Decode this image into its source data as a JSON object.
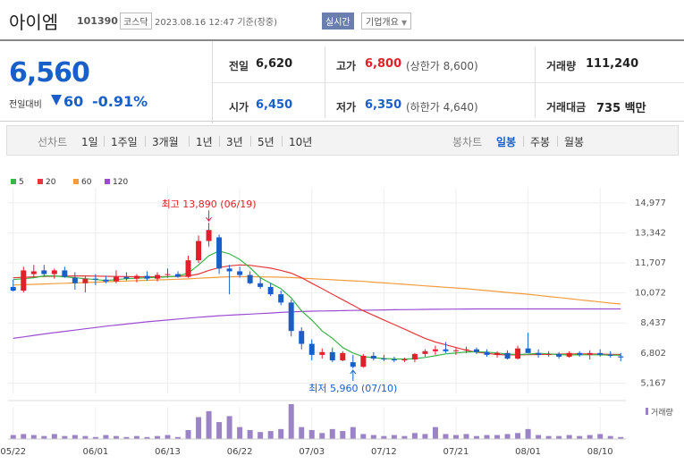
{
  "header": {
    "name": "아이엠",
    "code": "101390",
    "market": "코스닥",
    "time": "2023.08.16 12:47 기준(장중)",
    "realtime": "실시간",
    "company_info": "기업개요"
  },
  "summary": {
    "price": "6,560",
    "change_label": "전일대비",
    "change": "60",
    "change_pct": "-0.91%",
    "prev_label": "전일",
    "prev": "6,620",
    "open_label": "시가",
    "open": "6,450",
    "high_label": "고가",
    "high": "6,800",
    "upper_limit": "(상한가 8,600)",
    "low_label": "저가",
    "low": "6,350",
    "lower_limit": "(하한가 4,640)",
    "volume_label": "거래량",
    "volume": "111,240",
    "amount_label": "거래대금",
    "amount": "735 백만"
  },
  "toolbar": {
    "line_label": "선차트",
    "line_items": [
      "1일",
      "1주일",
      "3개월",
      "1년",
      "3년",
      "5년",
      "10년"
    ],
    "candle_label": "봉차트",
    "candle_items": [
      "일봉",
      "주봉",
      "월봉"
    ]
  },
  "chart_data": {
    "type": "candlestick",
    "legend": [
      "5",
      "20",
      "60",
      "120"
    ],
    "legend_colors": [
      "#3bb54a",
      "#e5383b",
      "#f39c3d",
      "#9b4dd1"
    ],
    "y_ticks": [
      "14,977",
      "13,342",
      "11,707",
      "10,072",
      "8,437",
      "6,802",
      "5,167"
    ],
    "y_values": [
      14977,
      13342,
      11707,
      10072,
      8437,
      6802,
      5167
    ],
    "ylim": [
      4600,
      15800
    ],
    "x_ticks": [
      "05/22",
      "06/01",
      "06/13",
      "06/22",
      "07/03",
      "07/12",
      "07/21",
      "08/01",
      "08/10"
    ],
    "x_tick_index": [
      0,
      8,
      15,
      22,
      29,
      36,
      43,
      50,
      57
    ],
    "max_annot": "최고 13,890 (06/19)",
    "min_annot": "최저 5,960 (07/10)",
    "volume_label": "거래량",
    "candles": [
      [
        10400,
        10800,
        10150,
        10200
      ],
      [
        10200,
        11500,
        10100,
        11300
      ],
      [
        11100,
        11600,
        10900,
        11250
      ],
      [
        11300,
        11600,
        10950,
        11100
      ],
      [
        11100,
        11400,
        10850,
        11300
      ],
      [
        11300,
        11500,
        10900,
        10950
      ],
      [
        10900,
        11200,
        10250,
        10600
      ],
      [
        10600,
        11000,
        10100,
        10850
      ],
      [
        10850,
        11100,
        10500,
        10800
      ],
      [
        10800,
        11000,
        10600,
        10700
      ],
      [
        10700,
        11300,
        10600,
        10950
      ],
      [
        10950,
        11200,
        10750,
        10850
      ],
      [
        10850,
        11100,
        10650,
        11000
      ],
      [
        11000,
        11250,
        10750,
        10850
      ],
      [
        10850,
        11200,
        10700,
        11050
      ],
      [
        11050,
        11400,
        10900,
        11100
      ],
      [
        11100,
        11250,
        10900,
        10950
      ],
      [
        10950,
        12100,
        10900,
        11850
      ],
      [
        11850,
        13200,
        11700,
        12900
      ],
      [
        12900,
        13890,
        12600,
        13500
      ],
      [
        13100,
        13250,
        11100,
        11400
      ],
      [
        11400,
        11600,
        10000,
        11250
      ],
      [
        11250,
        11500,
        10900,
        11050
      ],
      [
        11050,
        11250,
        10550,
        10600
      ],
      [
        10600,
        10900,
        10300,
        10400
      ],
      [
        10400,
        10600,
        9900,
        10000
      ],
      [
        10000,
        10200,
        9400,
        9550
      ],
      [
        9550,
        9700,
        7700,
        8000
      ],
      [
        8000,
        8200,
        7000,
        7300
      ],
      [
        7300,
        7550,
        6400,
        6700
      ],
      [
        6700,
        7050,
        6500,
        6850
      ],
      [
        6850,
        7100,
        6300,
        6400
      ],
      [
        6400,
        6900,
        6350,
        6800
      ],
      [
        6300,
        6700,
        5960,
        6050
      ],
      [
        6050,
        6750,
        6000,
        6650
      ],
      [
        6650,
        6850,
        6400,
        6500
      ],
      [
        6500,
        6700,
        6350,
        6450
      ],
      [
        6450,
        6600,
        6300,
        6400
      ],
      [
        6400,
        6550,
        6300,
        6450
      ],
      [
        6450,
        6800,
        6300,
        6750
      ],
      [
        6750,
        7000,
        6600,
        6900
      ],
      [
        6900,
        7200,
        6700,
        7000
      ],
      [
        7000,
        7400,
        6800,
        6900
      ],
      [
        6900,
        7100,
        6700,
        6950
      ],
      [
        6950,
        7150,
        6800,
        7000
      ],
      [
        7000,
        7100,
        6750,
        6850
      ],
      [
        6850,
        7000,
        6600,
        6700
      ],
      [
        6700,
        6900,
        6550,
        6800
      ],
      [
        6800,
        6950,
        6450,
        6500
      ],
      [
        6500,
        7200,
        6450,
        7050
      ],
      [
        7050,
        7900,
        6800,
        6800
      ],
      [
        6800,
        7000,
        6550,
        6700
      ],
      [
        6700,
        6900,
        6600,
        6750
      ],
      [
        6750,
        6850,
        6500,
        6600
      ],
      [
        6600,
        6900,
        6550,
        6800
      ],
      [
        6800,
        6900,
        6600,
        6700
      ],
      [
        6700,
        6950,
        6450,
        6800
      ],
      [
        6800,
        7000,
        6600,
        6700
      ],
      [
        6700,
        6900,
        6550,
        6650
      ],
      [
        6620,
        6800,
        6350,
        6560
      ]
    ],
    "volumes": [
      4,
      5,
      4,
      3,
      5,
      3,
      4,
      3,
      2,
      4,
      3,
      2,
      3,
      2,
      3,
      4,
      2,
      9,
      22,
      28,
      17,
      23,
      12,
      9,
      7,
      8,
      10,
      35,
      12,
      9,
      6,
      10,
      8,
      12,
      5,
      4,
      3,
      4,
      3,
      6,
      5,
      12,
      5,
      4,
      5,
      3,
      4,
      4,
      5,
      6,
      10,
      4,
      3,
      3,
      4,
      3,
      4,
      5,
      3,
      2
    ],
    "ma5": [
      10800,
      10850,
      10900,
      11000,
      11000,
      10950,
      10900,
      10850,
      10800,
      10750,
      10800,
      10850,
      10870,
      10900,
      10920,
      10950,
      11000,
      11150,
      11600,
      12100,
      12350,
      12200,
      11900,
      11450,
      10900,
      10600,
      10300,
      9800,
      9100,
      8600,
      8000,
      7600,
      7100,
      6800,
      6600,
      6550,
      6500,
      6480,
      6470,
      6500,
      6560,
      6650,
      6750,
      6800,
      6860,
      6870,
      6850,
      6800,
      6740,
      6720,
      6740,
      6780,
      6750,
      6720,
      6700,
      6700,
      6710,
      6700,
      6690,
      6680
    ],
    "ma20": [
      10900,
      10920,
      10950,
      10970,
      10980,
      10990,
      11000,
      11000,
      10990,
      10980,
      10970,
      10960,
      10950,
      10950,
      10950,
      10960,
      10970,
      11000,
      11100,
      11300,
      11450,
      11550,
      11600,
      11580,
      11500,
      11420,
      11300,
      11150,
      10900,
      10600,
      10300,
      10000,
      9700,
      9400,
      9100,
      8850,
      8600,
      8350,
      8100,
      7850,
      7600,
      7400,
      7250,
      7100,
      6950,
      6850,
      6780,
      6720,
      6700,
      6700,
      6710,
      6720,
      6730,
      6740,
      6750,
      6750,
      6750,
      6740,
      6730,
      6720
    ],
    "ma60": [
      10500,
      10520,
      10540,
      10560,
      10580,
      10600,
      10620,
      10640,
      10660,
      10680,
      10700,
      10720,
      10740,
      10760,
      10780,
      10800,
      10820,
      10840,
      10870,
      10900,
      10930,
      10950,
      10960,
      10960,
      10950,
      10940,
      10930,
      10910,
      10880,
      10850,
      10820,
      10790,
      10760,
      10730,
      10700,
      10660,
      10620,
      10580,
      10540,
      10500,
      10460,
      10420,
      10380,
      10340,
      10300,
      10250,
      10200,
      10150,
      10100,
      10050,
      10000,
      9940,
      9880,
      9820,
      9760,
      9700,
      9640,
      9580,
      9520,
      9470
    ],
    "ma120": [
      7600,
      7680,
      7760,
      7840,
      7910,
      7980,
      8050,
      8120,
      8190,
      8260,
      8320,
      8380,
      8440,
      8500,
      8550,
      8600,
      8650,
      8700,
      8750,
      8790,
      8830,
      8860,
      8890,
      8920,
      8950,
      8980,
      9010,
      9040,
      9060,
      9080,
      9090,
      9100,
      9110,
      9120,
      9130,
      9140,
      9150,
      9160,
      9165,
      9170,
      9175,
      9180,
      9185,
      9190,
      9195,
      9200,
      9200,
      9200,
      9200,
      9200,
      9200,
      9200,
      9200,
      9200,
      9200,
      9200,
      9200,
      9200,
      9200,
      9200
    ]
  }
}
